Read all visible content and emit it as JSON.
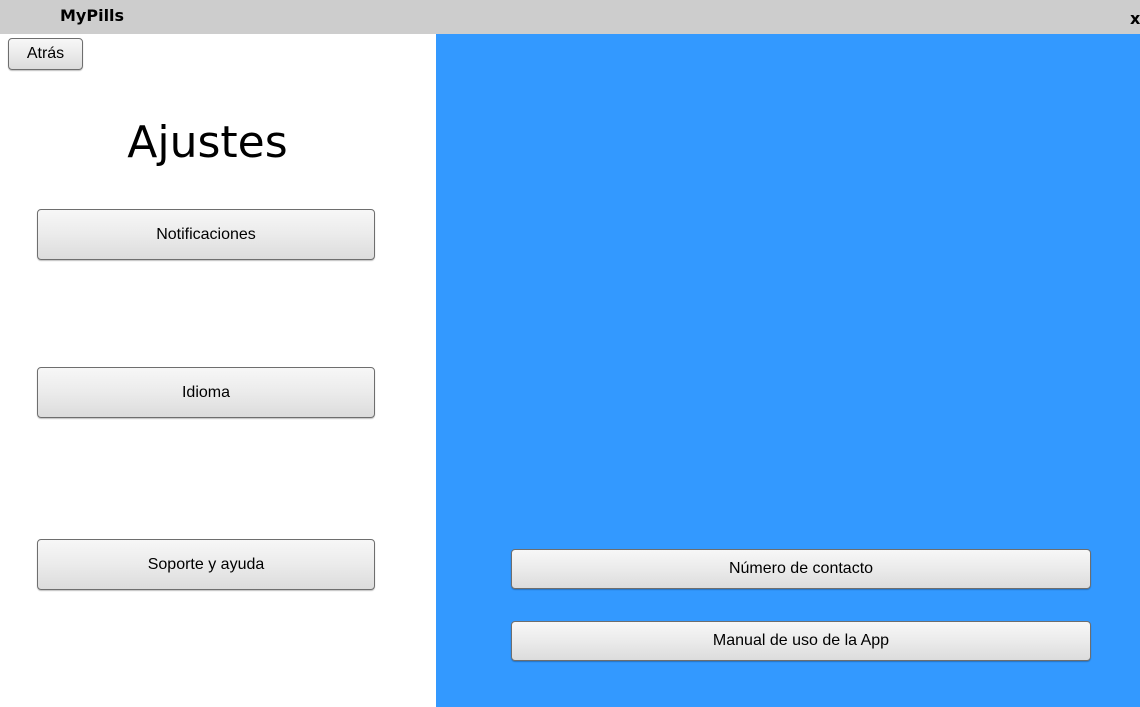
{
  "window": {
    "title": "MyPills",
    "close_label": "x"
  },
  "nav": {
    "back_label": "Atrás"
  },
  "page": {
    "title": "Ajustes"
  },
  "menu": {
    "items": [
      {
        "label": "Notificaciones"
      },
      {
        "label": "Idioma"
      },
      {
        "label": "Soporte y ayuda"
      }
    ]
  },
  "support": {
    "items": [
      {
        "label": "Número de contacto"
      },
      {
        "label": "Manual de uso de la App"
      }
    ]
  },
  "colors": {
    "titlebar": "#cdcdcd",
    "panel_accent": "#3399ff",
    "background": "#ffffff"
  }
}
